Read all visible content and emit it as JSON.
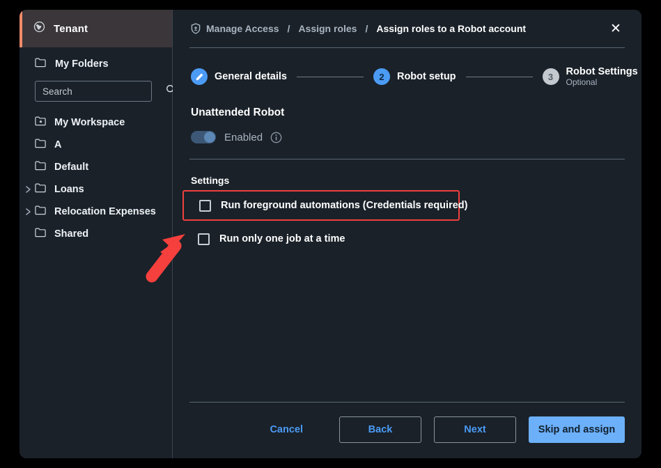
{
  "sidebar": {
    "tenant": {
      "label": "Tenant",
      "icon": "globe-icon",
      "accent_color": "#f08a6a"
    },
    "my_folders": {
      "label": "My Folders",
      "icon": "folder-icon"
    },
    "search": {
      "value": "",
      "placeholder": "Search",
      "icon": "search-icon"
    },
    "folders": [
      {
        "label": "My Workspace",
        "icon": "workspace-folder-icon",
        "expandable": false
      },
      {
        "label": "A",
        "icon": "folder-icon",
        "expandable": false
      },
      {
        "label": "Default",
        "icon": "folder-icon",
        "expandable": false
      },
      {
        "label": "Loans",
        "icon": "folder-icon",
        "expandable": true
      },
      {
        "label": "Relocation Expenses",
        "icon": "folder-icon",
        "expandable": true
      },
      {
        "label": "Shared",
        "icon": "folder-icon",
        "expandable": false
      }
    ]
  },
  "header": {
    "shield_icon": "shield-icon",
    "breadcrumb": [
      {
        "label": "Manage Access",
        "active": false
      },
      {
        "label": "Assign roles",
        "active": false
      },
      {
        "label": "Assign roles to a Robot account",
        "active": true
      }
    ],
    "separator": "/",
    "close_label": "✕"
  },
  "stepper": {
    "steps": [
      {
        "marker": "✎",
        "state": "done",
        "title": "General details",
        "subtitle": ""
      },
      {
        "marker": "2",
        "state": "current",
        "title": "Robot setup",
        "subtitle": ""
      },
      {
        "marker": "3",
        "state": "todo",
        "title": "Robot Settings",
        "subtitle": "Optional"
      }
    ]
  },
  "main": {
    "unattended_robot": {
      "title": "Unattended Robot",
      "toggle_label": "Enabled",
      "toggle_on": true,
      "info_icon": "info-icon"
    },
    "settings": {
      "title": "Settings",
      "checkboxes": [
        {
          "label": "Run foreground automations (Credentials required)",
          "checked": false,
          "highlighted": true
        },
        {
          "label": "Run only one job at a time",
          "checked": false,
          "highlighted": false
        }
      ]
    }
  },
  "footer": {
    "cancel_label": "Cancel",
    "back_label": "Back",
    "next_label": "Next",
    "skip_label": "Skip and assign"
  },
  "annotation": {
    "arrow_color": "#f0413e",
    "highlight_color": "#f0413e"
  },
  "colors": {
    "accent_blue": "#4b9bf5",
    "primary_button": "#6cb0fa",
    "background": "#1a2129",
    "tenant_bar": "#3b3639"
  }
}
